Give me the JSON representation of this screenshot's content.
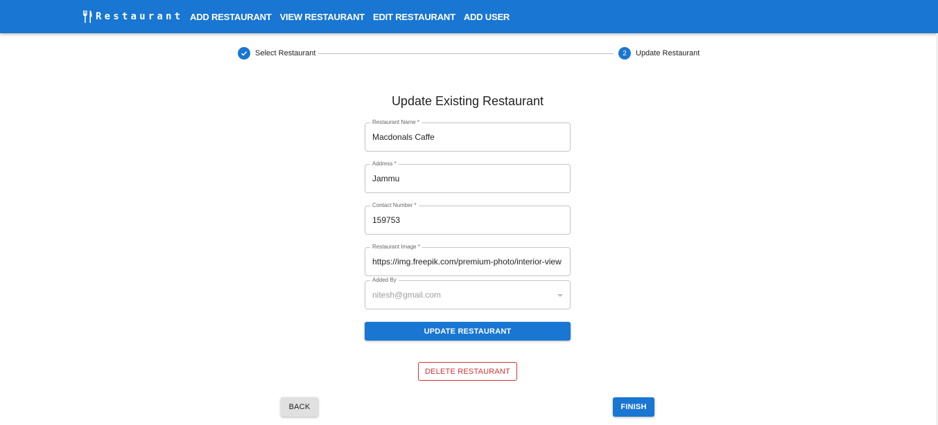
{
  "brand": {
    "name": "Restaurant",
    "icon": "fork-knife-icon"
  },
  "nav": {
    "items": [
      {
        "label": "ADD RESTAURANT"
      },
      {
        "label": "VIEW RESTAURANT"
      },
      {
        "label": "EDIT RESTAURANT"
      },
      {
        "label": "ADD USER"
      }
    ]
  },
  "stepper": {
    "steps": [
      {
        "label": "Select Restaurant",
        "state": "completed",
        "icon": "check-icon"
      },
      {
        "label": "Update Restaurant",
        "state": "active",
        "number": "2"
      }
    ]
  },
  "form": {
    "title": "Update Existing Restaurant",
    "fields": [
      {
        "label": "Restaurant Name *",
        "value": "Macdonals Caffe"
      },
      {
        "label": "Address *",
        "value": "Jammu"
      },
      {
        "label": "Contact Number *",
        "value": "159753"
      },
      {
        "label": "Restaurant Image *",
        "value": "https://img.freepik.com/premium-photo/interior-view"
      },
      {
        "label": "Added By",
        "value": "nitesh@gmail.com",
        "disabled": true
      }
    ],
    "update_label": "UPDATE RESTAURANT",
    "delete_label": "DELETE RESTAURANT"
  },
  "footer": {
    "back_label": "BACK",
    "finish_label": "FINISH"
  },
  "colors": {
    "primary": "#1976d2",
    "danger": "#d32f2f",
    "neutral_button": "#e0e0e0"
  }
}
